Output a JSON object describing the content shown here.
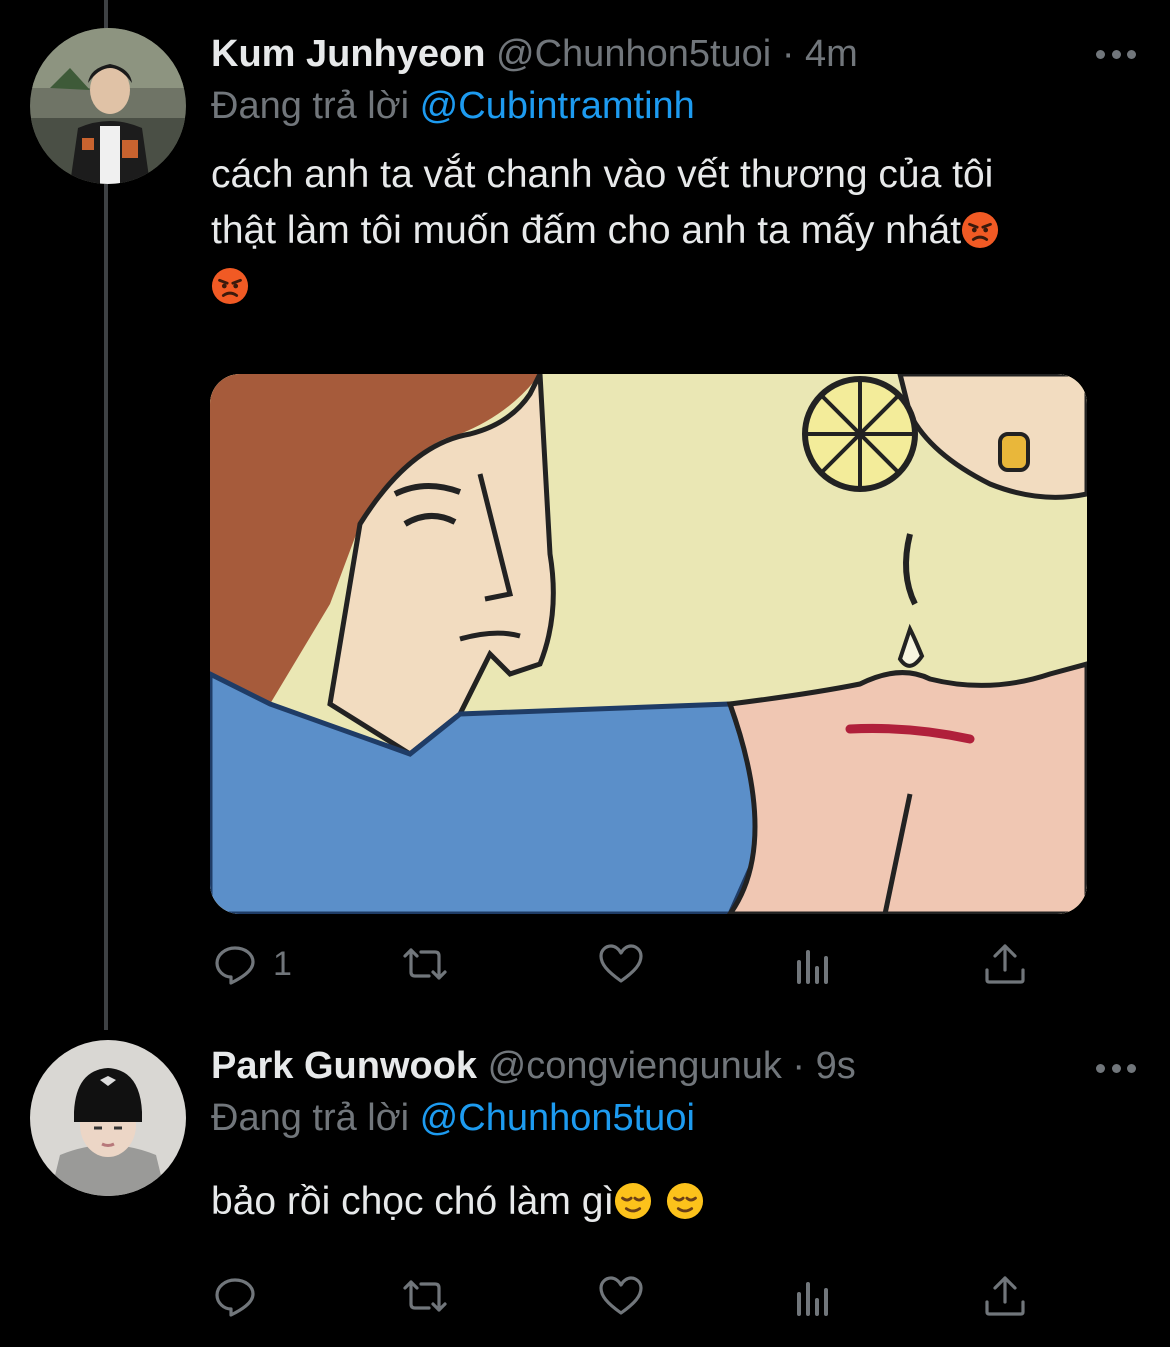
{
  "colors": {
    "background": "#000000",
    "text": "#e7e9ea",
    "muted": "#71767b",
    "accent": "#1d9bf0",
    "thread_line": "#3e4144"
  },
  "tweets": [
    {
      "display_name": "Kum Junhyeon",
      "handle": "@Chunhon5tuoi",
      "separator": "·",
      "time": "4m",
      "replying_prefix": "Đang trả lời",
      "replying_to": "@Cubintramtinh",
      "text_line1": "cách anh ta vắt chanh vào vết thương của tôi",
      "text_line2": "thật làm tôi muốn đấm cho anh ta mấy nhát",
      "emojis": [
        "pouting-face-emoji",
        "pouting-face-emoji"
      ],
      "has_media": true,
      "reply_count": "1",
      "icons": [
        "reply-icon",
        "retweet-icon",
        "like-icon",
        "analytics-icon",
        "share-icon",
        "more-icon"
      ]
    },
    {
      "display_name": "Park Gunwook",
      "handle": "@congviengunuk",
      "separator": "·",
      "time": "9s",
      "replying_prefix": "Đang trả lời",
      "replying_to": "@Chunhon5tuoi",
      "text": "bảo rồi chọc chó làm gì",
      "emojis": [
        "relieved-face-emoji",
        "relieved-face-emoji"
      ],
      "has_media": false,
      "reply_count": "",
      "icons": [
        "reply-icon",
        "retweet-icon",
        "like-icon",
        "analytics-icon",
        "share-icon",
        "more-icon"
      ]
    }
  ]
}
